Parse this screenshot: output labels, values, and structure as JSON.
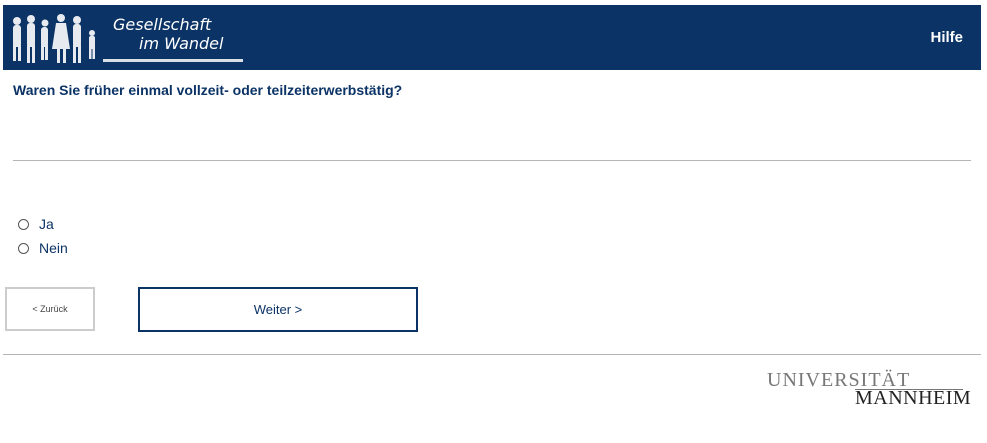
{
  "header": {
    "logo_line1": "Gesellschaft",
    "logo_line2": "im Wandel",
    "help_label": "Hilfe",
    "bg_color": "#0b3366"
  },
  "question": {
    "text": "Waren Sie früher einmal vollzeit- oder teilzeiterwerbstätig?"
  },
  "options": [
    {
      "label": "Ja",
      "selected": false
    },
    {
      "label": "Nein",
      "selected": false
    }
  ],
  "nav": {
    "back_label": "< Zurück",
    "next_label": "Weiter >"
  },
  "footer": {
    "logo_line1": "UNIVERSITÄT",
    "logo_line2": "MANNHEIM"
  }
}
